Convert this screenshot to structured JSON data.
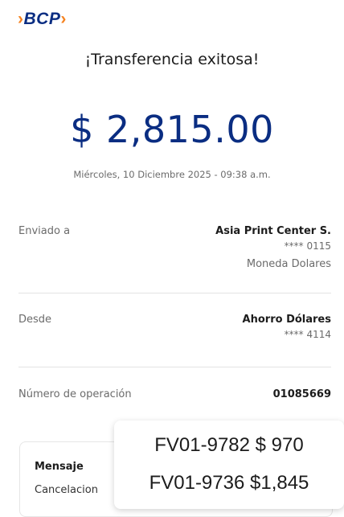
{
  "header": {
    "brand": "BCP",
    "chevron_left": "›",
    "chevron_right": "›"
  },
  "receipt": {
    "title": "¡Transferencia exitosa!",
    "amount": "$ 2,815.00",
    "datetime": "Miércoles, 10 Diciembre 2025 - 09:38 a.m."
  },
  "details": {
    "sent_to": {
      "label": "Enviado a",
      "name": "Asia Print Center S.",
      "account": "**** 0115",
      "currency": "Moneda Dolares"
    },
    "from": {
      "label": "Desde",
      "name": "Ahorro Dólares",
      "account": "**** 4114"
    },
    "operation": {
      "label": "Número de operación",
      "value": "01085669"
    }
  },
  "message": {
    "label": "Mensaje",
    "text": "Cancelacion"
  },
  "overlay_note": {
    "line1": "FV01-9782 $ 970",
    "line2": "FV01-9736 $1,845"
  },
  "colors": {
    "brand_blue": "#0a2d82",
    "brand_orange": "#f5821f"
  }
}
